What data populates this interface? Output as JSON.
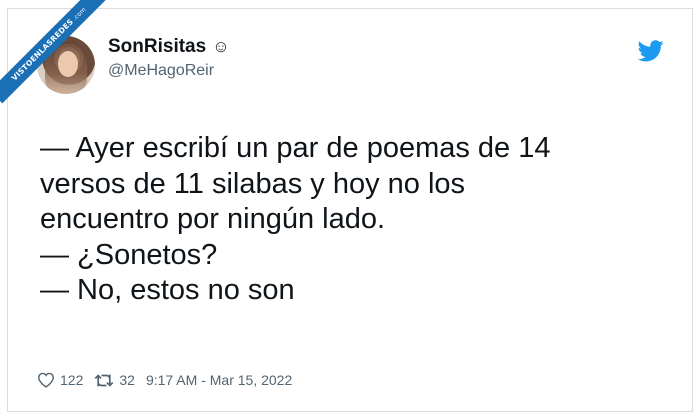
{
  "watermark": {
    "text": "VISTOENLASREDES",
    "suffix": ".com"
  },
  "author": {
    "display_name": "SonRisitas",
    "emoji": "☺",
    "handle": "@MeHagoReir"
  },
  "tweet": {
    "lines": [
      "— Ayer escribí un par de poemas de 14",
      "versos de 11 silabas y hoy no los",
      "encuentro por ningún lado.",
      "— ¿Sonetos?",
      "— No, estos no son"
    ]
  },
  "meta": {
    "likes": "122",
    "retweets": "32",
    "timestamp": "9:17 AM - Mar 15, 2022"
  },
  "colors": {
    "twitter_blue": "#1d9bf0",
    "ribbon_blue": "#1b6fb5",
    "text": "#0f1419",
    "secondary": "#536471"
  }
}
